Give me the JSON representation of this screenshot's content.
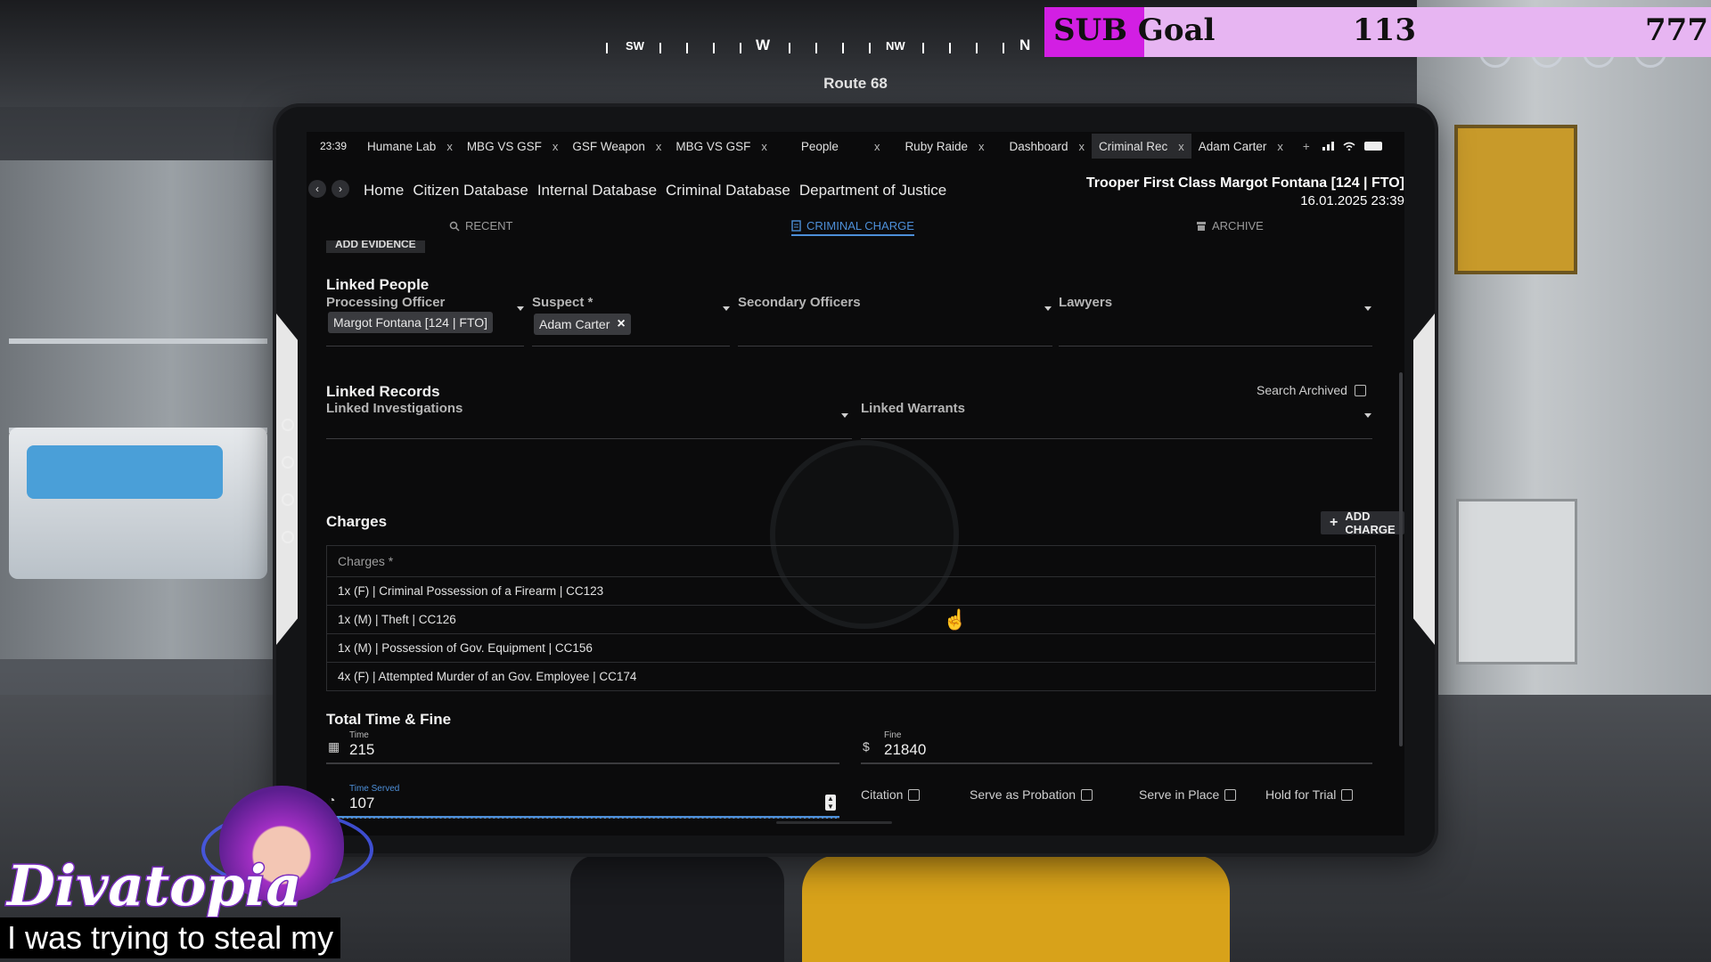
{
  "hud": {
    "compass": {
      "sw": "SW",
      "w": "W",
      "nw": "NW",
      "n": "N"
    },
    "route": "Route 68",
    "sub_goal": {
      "label": "SUB Goal",
      "current": "113",
      "target": "777",
      "accent": "#d21fe3",
      "bg": "#e7b5f2"
    }
  },
  "tablet": {
    "clock": "23:39",
    "tabs": [
      {
        "label": "Humane Lab",
        "close": "x",
        "active": false
      },
      {
        "label": "MBG VS GSF",
        "close": "x",
        "active": false
      },
      {
        "label": "GSF Weapon",
        "close": "x",
        "active": false
      },
      {
        "label": "MBG VS GSF",
        "close": "x",
        "active": false
      },
      {
        "label": "People",
        "close": "x",
        "active": false
      },
      {
        "label": "Ruby Raide",
        "close": "x",
        "active": false
      },
      {
        "label": "Dashboard",
        "close": "x",
        "active": false
      },
      {
        "label": "Criminal Rec",
        "close": "x",
        "active": true
      },
      {
        "label": "Adam Carter",
        "close": "x",
        "active": false
      }
    ],
    "new_tab": "+",
    "nav": {
      "back": "‹",
      "forward": "›",
      "crumbs": [
        "Home",
        "Citizen Database",
        "Internal Database",
        "Criminal Database",
        "Department of Justice"
      ]
    },
    "officer": {
      "name": "Trooper First Class Margot Fontana [124 | FTO]",
      "datetime": "16.01.2025 23:39"
    },
    "subtabs": {
      "recent": "RECENT",
      "criminal_charge": "CRIMINAL CHARGE",
      "archive": "ARCHIVE"
    },
    "add_evidence": "ADD EVIDENCE",
    "linked_people": {
      "title": "Linked People",
      "processing_officer_label": "Processing Officer",
      "processing_officer": "Margot Fontana [124 | FTO]",
      "suspect_label": "Suspect *",
      "suspect": "Adam Carter",
      "secondary_officers_label": "Secondary Officers",
      "lawyers_label": "Lawyers"
    },
    "linked_records": {
      "title": "Linked Records",
      "search_archived": "Search Archived",
      "investigations_label": "Linked Investigations",
      "warrants_label": "Linked Warrants"
    },
    "charges": {
      "title": "Charges",
      "add_button": "ADD CHARGE",
      "header": "Charges *",
      "rows": [
        "1x (F) | Criminal Possession of a Firearm | CC123",
        "1x (M) | Theft | CC126",
        "1x (M) | Possession of Gov. Equipment | CC156",
        "4x (F) | Attempted Murder of an Gov. Employee | CC174"
      ]
    },
    "totals": {
      "title": "Total Time & Fine",
      "time_label": "Time",
      "time": "215",
      "fine_label": "Fine",
      "fine_currency": "$",
      "fine": "21840",
      "time_served_label": "Time Served",
      "time_served": "107"
    },
    "options": {
      "citation": "Citation",
      "probation": "Serve as Probation",
      "in_place": "Serve in Place",
      "hold_trial": "Hold for Trial"
    }
  },
  "overlay": {
    "streamer": "Divatopia",
    "caption": "I was trying to steal my"
  },
  "colors": {
    "accent_blue": "#4d8fd8",
    "panel": "#0b0b0c"
  }
}
